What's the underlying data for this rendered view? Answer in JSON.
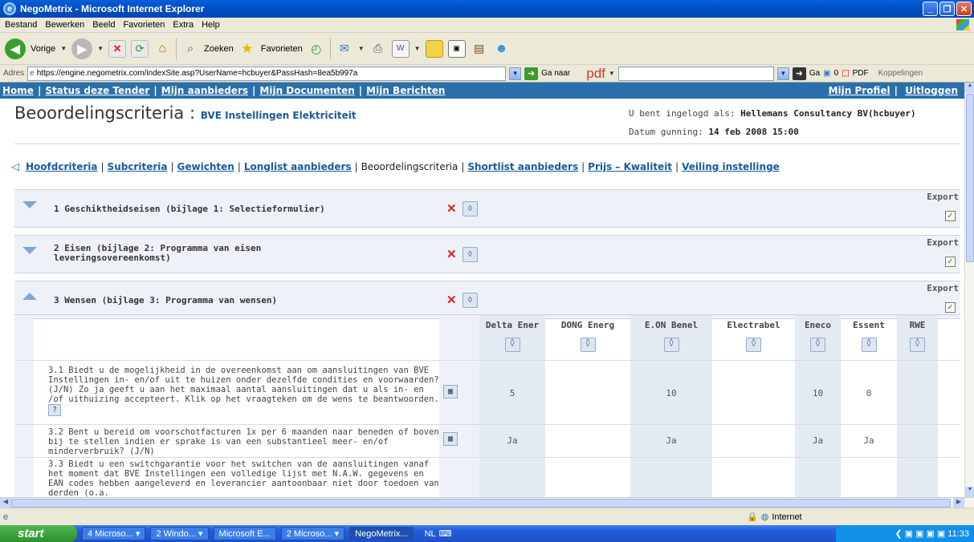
{
  "window": {
    "title": "NegoMetrix - Microsoft Internet Explorer"
  },
  "menu": [
    "Bestand",
    "Bewerken",
    "Beeld",
    "Favorieten",
    "Extra",
    "Help"
  ],
  "toolbar": {
    "back": "Vorige",
    "search": "Zoeken",
    "favorites": "Favorieten"
  },
  "address": {
    "label": "Adres",
    "url": "https://engine.negometrix.com/indexSite.asp?UserName=hcbuyer&PassHash=8ea5b997a",
    "go": "Ga naar",
    "pdf": "pdf",
    "ga": "Ga",
    "count": "0",
    "pdf_button": "PDF",
    "links": "Koppelingen"
  },
  "topnav": {
    "left": [
      "Home",
      "Status deze Tender",
      "Mijn aanbieders",
      "Mijn Documenten",
      "Mijn Berichten"
    ],
    "right": [
      "Mijn Profiel",
      "Uitloggen"
    ]
  },
  "header": {
    "title": "Beoordelingscriteria",
    "colon": ":",
    "subtitle": "BVE Instellingen Elektriciteit",
    "login_label": "U bent ingelogd als:",
    "login_user": "Hellemans Consultancy BV(hcbuyer)",
    "date_label": "Datum gunning:",
    "date_value": "14 feb 2008 15:00"
  },
  "tabs": [
    {
      "label": "Hoofdcriteria",
      "link": true
    },
    {
      "label": "Subcriteria",
      "link": true
    },
    {
      "label": "Gewichten",
      "link": true
    },
    {
      "label": "Longlist aanbieders",
      "link": true
    },
    {
      "label": "Beoordelingscriteria",
      "link": false
    },
    {
      "label": "Shortlist aanbieders",
      "link": true
    },
    {
      "label": "Prijs – Kwaliteit",
      "link": true
    },
    {
      "label": "Veiling instellinge",
      "link": true
    }
  ],
  "criteria": [
    {
      "title": "1 Geschiktheidseisen (bijlage 1: Selectieformulier)",
      "expanded": false
    },
    {
      "title": "2 Eisen (bijlage 2: Programma van eisen\nleveringsovereenkomst)",
      "expanded": false
    },
    {
      "title": "3 Wensen (bijlage 3: Programma van wensen)",
      "expanded": true
    }
  ],
  "export_label": "Export",
  "suppliers": [
    "Delta Ener",
    "DONG Energ",
    "E.ON Benel",
    "Electrabel",
    "Eneco",
    "Essent",
    "RWE"
  ],
  "questions": [
    {
      "text": "3.1 Biedt u de mogelijkheid in de overeenkomst aan om aansluitingen van BVE Instellingen in- en/of uit te huizen onder dezelfde condities en voorwaarden? (J/N) Zo ja geeft u aan het maximaal aantal aansluitingen dat u als in- en /of uithuizing accepteert. Klik op het vraagteken om de wens te beantwoorden.",
      "values": [
        "5",
        "",
        "10",
        "",
        "10",
        "0",
        ""
      ]
    },
    {
      "text": "3.2 Bent u bereid om voorschotfacturen 1x per 6 maanden naar beneden of boven bij te stellen indien er sprake is van een substantieel meer- en/of minderverbruik? (J/N)",
      "values": [
        "Ja",
        "",
        "Ja",
        "",
        "Ja",
        "Ja",
        ""
      ]
    },
    {
      "text": "3.3 Biedt u een switchgarantie voor het switchen van de aansluitingen vanaf het moment dat BVE Instellingen een volledige lijst met N.A.W. gegevens en EAN codes hebben aangeleverd en leverancier aantoonbaar niet door toedoen van derden (o.a.",
      "values": [
        "",
        "",
        "",
        "",
        "",
        "",
        ""
      ]
    }
  ],
  "status": {
    "zone": "Internet"
  },
  "taskbar": {
    "start": "start",
    "tasks": [
      "4 Microso...",
      "2 Windo...",
      "Microsoft E...",
      "2 Microso...",
      "NegoMetrix..."
    ],
    "lang": "NL",
    "clock": "11:33"
  }
}
